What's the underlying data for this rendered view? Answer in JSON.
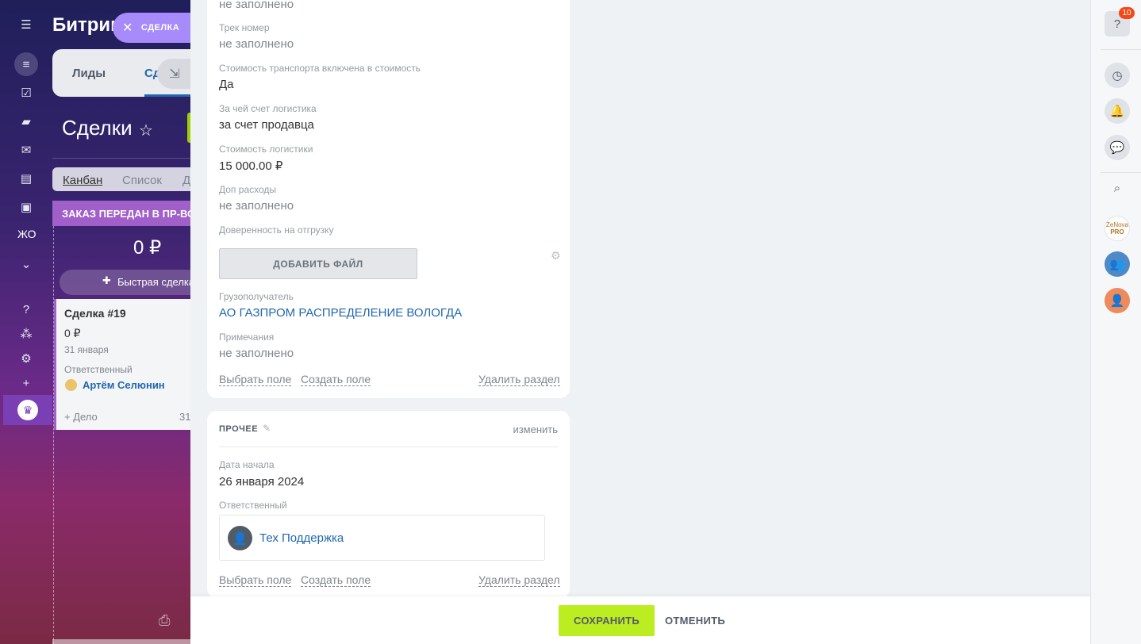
{
  "background": {
    "app_title": "Битрик",
    "crm_tabs": [
      "Лиды",
      "Сд"
    ],
    "page_heading": "Сделки",
    "view_tabs": [
      "Канбан",
      "Список",
      "Д"
    ],
    "stage": {
      "title": "ЗАКАЗ ПЕРЕДАН В ПР-ВО",
      "sum": "0 ₽",
      "quick_deal": "Быстрая сделка"
    },
    "deal_card": {
      "title": "Сделка #19",
      "sum": "0 ₽",
      "date": "31 января",
      "responsible_label": "Ответственный",
      "responsible_name": "Артём Селюнин",
      "activity": "+ Дело",
      "activity_count": "31"
    },
    "rail_text": "ЖО"
  },
  "slider_chip": {
    "label": "СДЕЛКА"
  },
  "top_section": {
    "fields": [
      {
        "label": "",
        "value": "не заполнено",
        "style": "muted"
      },
      {
        "label": "Трек номер",
        "value": "не заполнено",
        "style": "muted"
      },
      {
        "label": "Стоимость транспорта включена в стоимость",
        "value": "Да",
        "style": "normal"
      },
      {
        "label": "За чей счет логистика",
        "value": "за счет продавца",
        "style": "normal"
      },
      {
        "label": "Стоимость логистики",
        "value": "15 000.00 ₽",
        "style": "normal"
      },
      {
        "label": "Доп расходы",
        "value": "не заполнено",
        "style": "muted"
      }
    ],
    "power_of_attorney_label": "Доверенность на отгрузку",
    "add_file_label": "ДОБАВИТЬ ФАЙЛ",
    "consignee_label": "Грузополучатель",
    "consignee_value": "АО ГАЗПРОМ РАСПРЕДЕЛЕНИЕ ВОЛОГДА",
    "notes_label": "Примечания",
    "notes_value": "не заполнено",
    "footer": {
      "select_field": "Выбрать поле",
      "create_field": "Создать поле",
      "delete_section": "Удалить раздел"
    }
  },
  "other_section": {
    "title": "ПРОЧЕЕ",
    "change_label": "изменить",
    "start_date_label": "Дата начала",
    "start_date_value": "26 января 2024",
    "responsible_label": "Ответственный",
    "responsible_name": "Тех Поддержка",
    "footer": {
      "select_field": "Выбрать поле",
      "create_field": "Создать поле",
      "delete_section": "Удалить раздел"
    }
  },
  "actions": {
    "save": "СОХРАНИТЬ",
    "cancel": "ОТМЕНИТЬ"
  },
  "right_panel": {
    "help_badge": "10",
    "logo_line1": "ZeNova",
    "logo_line2": "PRO"
  },
  "colors": {
    "save_button": "#bbed21",
    "link": "#2067b0",
    "badge": "#f54819",
    "stage": "#a05fc9"
  }
}
